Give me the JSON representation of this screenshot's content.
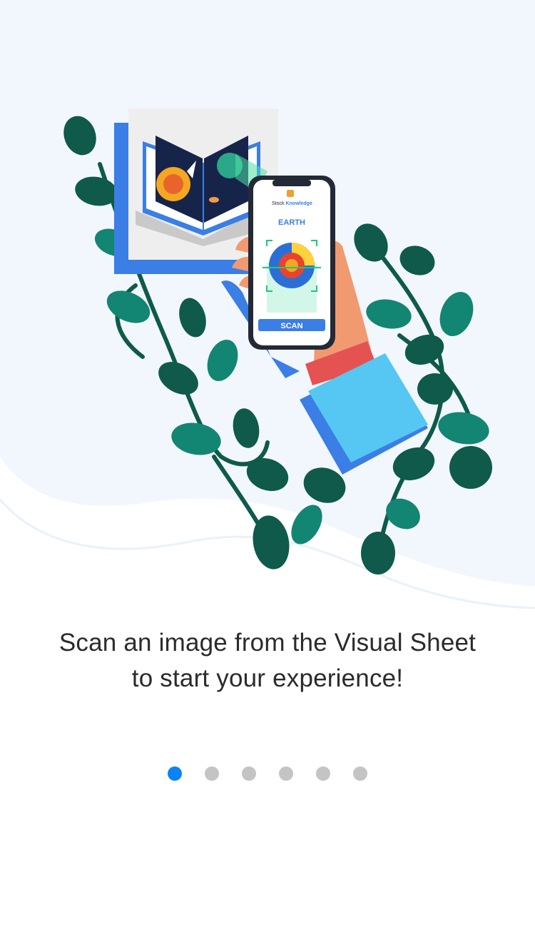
{
  "colors": {
    "accent": "#0a84f5",
    "dot_inactive": "#c4c4c4",
    "background_wave": "#f2f7fe",
    "phone_frame": "#232a36",
    "book_blue": "#3a7ee6",
    "leaf_dark": "#0f5a4a",
    "leaf_mid": "#138573",
    "sleeve": "#55c7f2",
    "cuff": "#e55252",
    "skin": "#f19a70"
  },
  "illustration": {
    "phone": {
      "app_name_prefix": "Stock",
      "app_name_suffix": "Knowledge",
      "subject_label": "EARTH",
      "scan_button_label": "SCAN"
    }
  },
  "onboarding": {
    "caption_line1": "Scan an image from the Visual Sheet",
    "caption_line2": "to start your experience!",
    "page_count": 6,
    "active_index": 0
  }
}
